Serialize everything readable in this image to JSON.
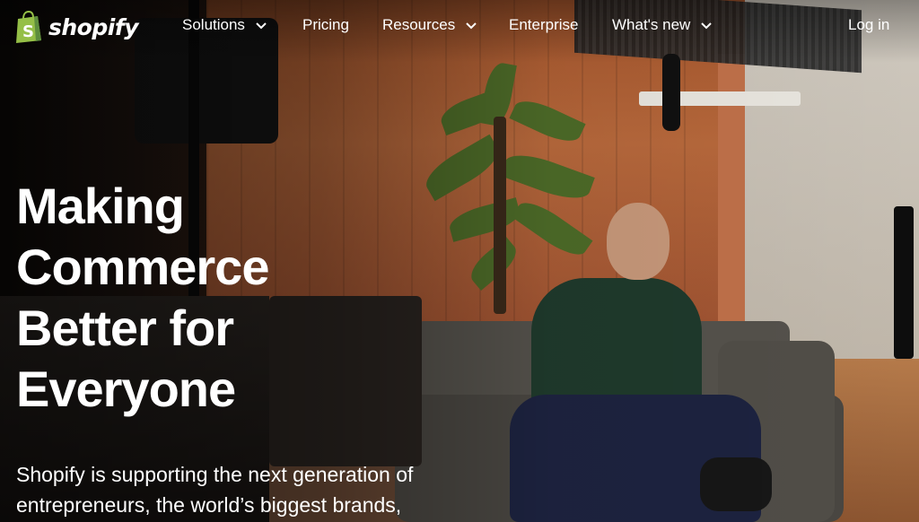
{
  "brand": {
    "name": "shopify"
  },
  "nav": {
    "solutions": "Solutions",
    "pricing": "Pricing",
    "resources": "Resources",
    "enterprise": "Enterprise",
    "whats_new": "What's new",
    "login": "Log in"
  },
  "hero": {
    "title_lines": [
      "Making",
      "Commerce",
      "Better for",
      "Everyone"
    ],
    "subtitle_lines": [
      "Shopify is supporting the next generation of",
      "entrepreneurs, the world’s biggest brands,"
    ]
  },
  "colors": {
    "logo_green": "#95bf47",
    "logo_dark_green": "#5e8e3e",
    "text": "#ffffff"
  },
  "icons": {
    "logo": "shopify-bag-icon",
    "dropdown": "chevron-down-icon"
  }
}
